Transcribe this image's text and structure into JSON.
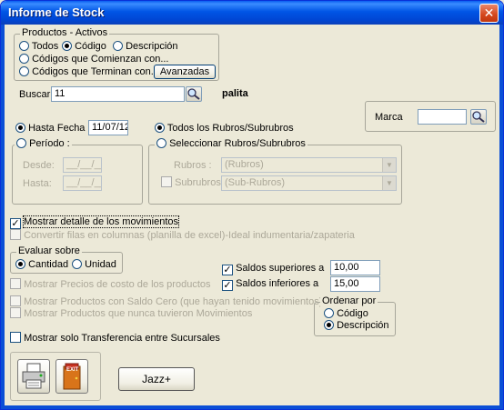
{
  "window": {
    "title": "Informe de Stock",
    "close_glyph": "✕"
  },
  "productos": {
    "legend": "Productos - Activos",
    "opt_todos": "Todos",
    "opt_codigo": "Código",
    "opt_descripcion": "Descripción",
    "opt_comienzan": "Códigos que Comienzan con...",
    "opt_terminan": "Códigos que Terminan con...",
    "avanzadas_label": "Avanzadas",
    "selected": "codigo"
  },
  "buscar": {
    "label": "Buscar:",
    "value": "11",
    "result": "palita"
  },
  "marca": {
    "label": "Marca",
    "value": ""
  },
  "fecha": {
    "hasta_fecha_label": "Hasta Fecha :",
    "hasta_fecha_value": "11/07/12",
    "periodo_label": "Período :",
    "desde_label": "Desde:",
    "desde_value": "__/__/__",
    "hasta_label": "Hasta:",
    "hasta_value": "__/__/__"
  },
  "rubros": {
    "todos_label": "Todos los Rubros/Subrubros",
    "seleccionar_label": "Seleccionar Rubros/Subrubros",
    "rubros_label": "Rubros :",
    "rubros_value": "(Rubros)",
    "subrubros_label": "Subrubros :",
    "subrubros_value": "(Sub-Rubros)"
  },
  "options": {
    "mostrar_detalle": "Mostrar detalle de los movimientos",
    "convertir_filas": "Convertir filas en columnas (planilla de excel)-Ideal indumentaria/zapateria",
    "mostrar_precios": "Mostrar Precios de costo de los productos",
    "mostrar_saldo_cero": "Mostrar Productos con Saldo Cero (que hayan tenido movimientos)",
    "mostrar_nunca": "Mostrar Productos que nunca tuvieron Movimientos",
    "mostrar_transferencia": "Mostrar solo Transferencia entre Sucursales"
  },
  "evaluar": {
    "legend": "Evaluar sobre",
    "cantidad": "Cantidad",
    "unidad": "Unidad"
  },
  "saldos": {
    "superiores_label": "Saldos superiores a",
    "superiores_value": "10,00",
    "inferiores_label": "Saldos inferiores a",
    "inferiores_value": "15,00"
  },
  "ordenar": {
    "legend": "Ordenar por",
    "codigo": "Código",
    "descripcion": "Descripción"
  },
  "buttons": {
    "jazz_label": "Jazz+",
    "exit_label": "EXIT"
  },
  "check_glyph": "✓"
}
